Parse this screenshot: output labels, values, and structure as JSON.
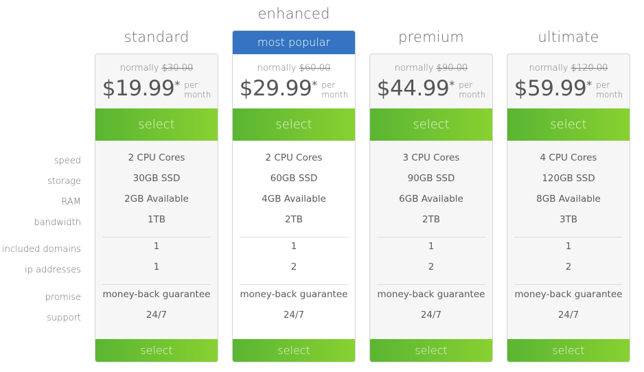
{
  "row_labels": [
    "speed",
    "storage",
    "RAM",
    "bandwidth",
    "included domains",
    "ip addresses",
    "promise",
    "support"
  ],
  "normally_label": "normally",
  "per_label": "per",
  "month_label": "month",
  "asterisk": "*",
  "select_label": "select",
  "plans": [
    {
      "name": "standard",
      "featured": false,
      "normal_price": "$30.00",
      "price": "$19.99",
      "values": [
        "2 CPU Cores",
        "30GB SSD",
        "2GB Available",
        "1TB",
        "1",
        "1",
        "money-back guarantee",
        "24/7"
      ]
    },
    {
      "name": "enhanced",
      "featured": true,
      "ribbon": "most popular",
      "normal_price": "$60.00",
      "price": "$29.99",
      "values": [
        "2 CPU Cores",
        "60GB SSD",
        "4GB Available",
        "2TB",
        "1",
        "2",
        "money-back guarantee",
        "24/7"
      ]
    },
    {
      "name": "premium",
      "featured": false,
      "normal_price": "$90.00",
      "price": "$44.99",
      "values": [
        "3 CPU Cores",
        "90GB SSD",
        "6GB Available",
        "2TB",
        "1",
        "2",
        "money-back guarantee",
        "24/7"
      ]
    },
    {
      "name": "ultimate",
      "featured": false,
      "normal_price": "$120.00",
      "price": "$59.99",
      "values": [
        "4 CPU Cores",
        "120GB SSD",
        "8GB Available",
        "3TB",
        "1",
        "2",
        "money-back guarantee",
        "24/7"
      ]
    }
  ],
  "colors": {
    "ribbon_blue": "#3474c2",
    "select_green_start": "#5ab532",
    "select_green_end": "#88d131"
  }
}
